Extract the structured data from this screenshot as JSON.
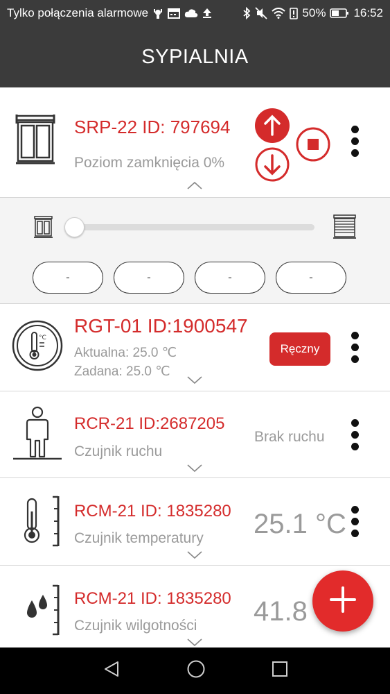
{
  "status_bar": {
    "carrier": "Tylko połączenia alarmowe",
    "battery": "50%",
    "time": "16:52"
  },
  "header": {
    "title": "SYPIALNIA"
  },
  "devices": [
    {
      "title": "SRP-22 ID: 797694",
      "subtitle": "Poziom zamknięcia 0%",
      "icon": "window-shutter-icon"
    },
    {
      "title": "RGT-01 ID:1900547",
      "line1": "Aktualna: 25.0 ℃",
      "line2": "Zadana: 25.0 ℃",
      "mode": "Ręczny",
      "icon": "thermostat-icon"
    },
    {
      "title": "RCR-21 ID:2687205",
      "subtitle": "Czujnik ruchu",
      "value": "Brak ruchu",
      "icon": "person-motion-icon"
    },
    {
      "title": "RCM-21 ID: 1835280",
      "subtitle": "Czujnik temperatury",
      "value": "25.1 °C",
      "icon": "thermometer-icon"
    },
    {
      "title": "RCM-21 ID: 1835280",
      "subtitle": "Czujnik wilgotności",
      "value": "41.8 %",
      "icon": "humidity-drops-icon"
    }
  ],
  "shutter_panel": {
    "level": 0,
    "presets": [
      "-",
      "-",
      "-",
      "-"
    ]
  },
  "colors": {
    "accent_red": "#d42b2b",
    "app_bar": "#3b3b3b",
    "fab": "#e22b2b"
  }
}
